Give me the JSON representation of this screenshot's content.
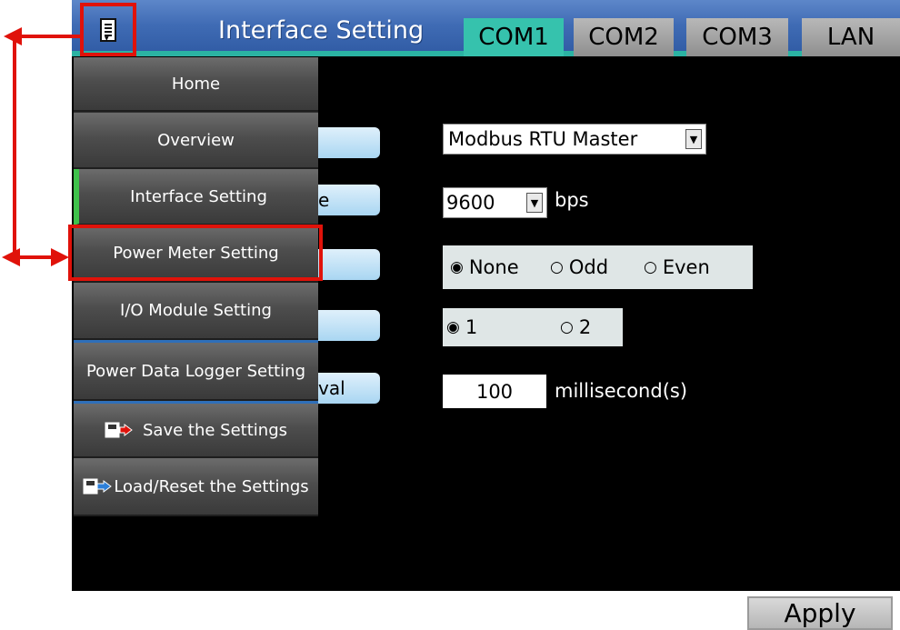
{
  "header": {
    "title": "Interface Setting",
    "tabs": [
      {
        "label": "COM1",
        "active": true
      },
      {
        "label": "COM2",
        "active": false
      },
      {
        "label": "COM3",
        "active": false
      },
      {
        "label": "LAN",
        "active": false
      }
    ]
  },
  "menu": {
    "items": [
      {
        "label": "Home"
      },
      {
        "label": "Overview"
      },
      {
        "label": "Interface Setting"
      },
      {
        "label": "Power Meter Setting"
      },
      {
        "label": "I/O Module Setting"
      },
      {
        "label": "Power Data Logger Setting"
      },
      {
        "label": "Save the Settings",
        "icon": "save-icon"
      },
      {
        "label": "Load/Reset the Settings",
        "icon": "load-icon"
      }
    ]
  },
  "form": {
    "interval_label_fragment": "val",
    "baudrate_fragment": "e",
    "protocol": "Modbus RTU Master",
    "baudrate": "9600",
    "baudrate_unit": "bps",
    "parity_options": [
      "None",
      "Odd",
      "Even"
    ],
    "parity_selected": "None",
    "stopbit_options": [
      "1",
      "2"
    ],
    "stopbit_selected": "1",
    "interval": "100",
    "interval_unit": "millisecond(s)"
  },
  "footer": {
    "apply_label": "Apply"
  },
  "colors": {
    "annotation": "#e0120a",
    "active_tab": "#36c2ad",
    "header": "#3f6bb4"
  }
}
